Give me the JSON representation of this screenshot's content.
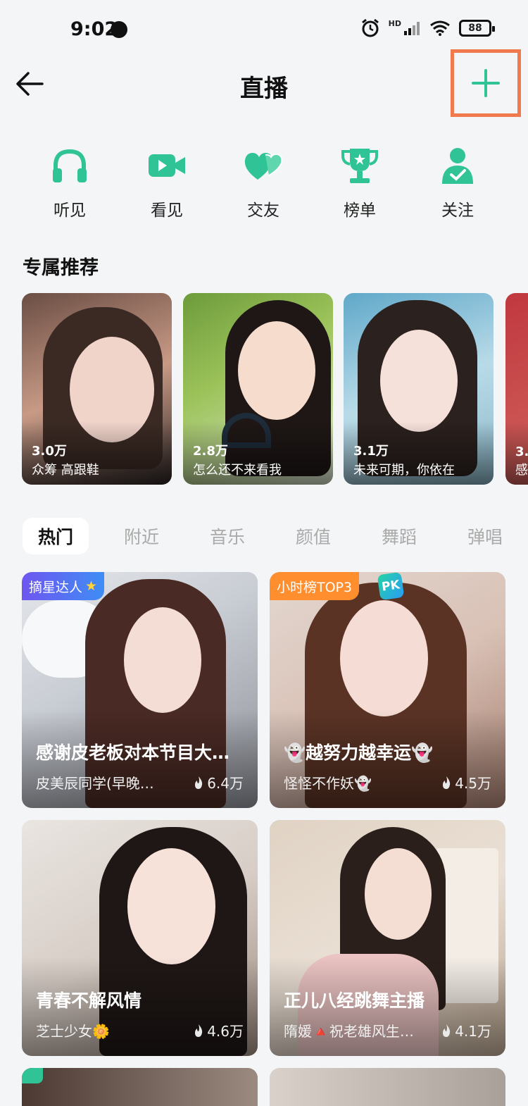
{
  "status": {
    "time": "9:02",
    "battery": "88",
    "network": "HD"
  },
  "header": {
    "title": "直播"
  },
  "categories": [
    {
      "label": "听见",
      "icon": "headphones-icon"
    },
    {
      "label": "看见",
      "icon": "video-camera-icon"
    },
    {
      "label": "交友",
      "icon": "hearts-icon"
    },
    {
      "label": "榜单",
      "icon": "trophy-icon"
    },
    {
      "label": "关注",
      "icon": "follow-user-icon"
    }
  ],
  "recommend": {
    "title": "专属推荐",
    "items": [
      {
        "count": "3.0万",
        "name": "众筹 高跟鞋"
      },
      {
        "count": "2.8万",
        "name": "怎么还不来看我"
      },
      {
        "count": "3.1万",
        "name": "未来可期，你依在"
      },
      {
        "count": "3.",
        "name": "感"
      }
    ]
  },
  "tabs": [
    "热门",
    "附近",
    "音乐",
    "颜值",
    "舞蹈",
    "弹唱"
  ],
  "cards": [
    {
      "badge": "摘星达人",
      "title": "感谢皮老板对本节目大…",
      "host": "皮美辰同学(早晚…",
      "heat": "6.4万"
    },
    {
      "badge": "小时榜TOP3",
      "pk": "PK",
      "title": "👻越努力越幸运👻",
      "host": "怪怪不作妖👻",
      "heat": "4.5万"
    },
    {
      "title": "青春不解风情",
      "host": "芝士少女🌼",
      "heat": "4.6万"
    },
    {
      "title": "正儿八经跳舞主播",
      "host": "隋媛🔺祝老雄风生…",
      "heat": "4.1万"
    }
  ],
  "colors": {
    "accent": "#2fc395",
    "highlight_box": "#f07a4e"
  }
}
